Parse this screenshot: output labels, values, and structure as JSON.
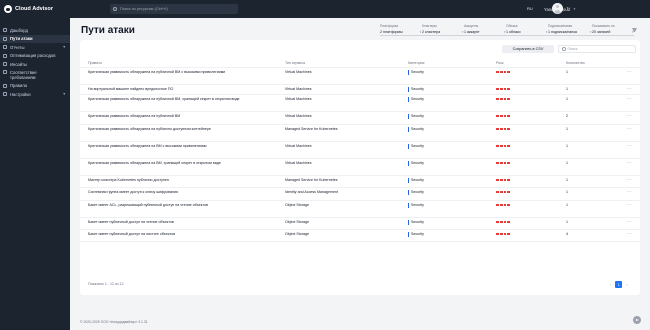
{
  "brand": {
    "name": "Cloud Advisor"
  },
  "sidebar": {
    "items": [
      {
        "label": "Дашборд"
      },
      {
        "label": "Пути атаки"
      },
      {
        "label": "Отчеты"
      },
      {
        "label": "Оптимизация расходов"
      },
      {
        "label": "Инсайты"
      },
      {
        "label": "Соответствие требованиям"
      },
      {
        "label": "Правила"
      },
      {
        "label": "Настройки"
      }
    ]
  },
  "topbar": {
    "search_placeholder": "Поиск по ресурсам (Ctrl+K)",
    "lang": "RU",
    "cloud": "Yandex Cloud"
  },
  "page": {
    "title": "Пути атаки"
  },
  "filters": [
    {
      "label": "Платформа",
      "value": "2 платформы"
    },
    {
      "label": "Кластеры",
      "value": "2 кластера"
    },
    {
      "label": "Аккаунты",
      "value": "1 аккаунт"
    },
    {
      "label": "Облака",
      "value": "1 облако"
    },
    {
      "label": "Подписки/папки",
      "value": "1 подписка/папка"
    },
    {
      "label": "Показывать по",
      "value": "20 записей"
    }
  ],
  "toolbar": {
    "export_label": "Сохранить в CSV",
    "search_placeholder": "Поиск"
  },
  "table": {
    "headers": {
      "rule": "Правило",
      "service": "Тип сервиса",
      "category": "Категория",
      "risk": "Риск",
      "count": "Количество"
    },
    "rows": [
      {
        "rule": "Критическая уязвимость обнаружена на публичной ВМ с высокими привилегиями",
        "service": "Virtual Machines",
        "category": "Security",
        "count": "1"
      },
      {
        "rule": "На виртуальной машине найдено вредоносное ПО",
        "service": "Virtual Machines",
        "category": "Security",
        "count": "1"
      },
      {
        "rule": "Критическая уязвимость обнаружена на публичной ВМ, хранящей секрет в открытом виде",
        "service": "Virtual Machines",
        "category": "Security",
        "count": "1"
      },
      {
        "rule": "Критическая уязвимость обнаружена на публичной ВМ",
        "service": "Virtual Machines",
        "category": "Security",
        "count": "2"
      },
      {
        "rule": "Критическая уязвимость обнаружена на публично доступном контейнере",
        "service": "Managed Service for Kubernetes",
        "category": "Security",
        "count": "1"
      },
      {
        "rule": "Критическая уязвимость обнаружена на ВМ с высокими привилегиями",
        "service": "Virtual Machines",
        "category": "Security",
        "count": "1"
      },
      {
        "rule": "Критическая уязвимость обнаружена на ВМ, хранящей секрет в открытом виде",
        "service": "Virtual Machines",
        "category": "Security",
        "count": "1"
      },
      {
        "rule": "Мастер кластера Kubernetes публично доступен",
        "service": "Managed Service for Kubernetes",
        "category": "Security",
        "count": "1"
      },
      {
        "rule": "Системная группа имеет доступ к ключу шифрования",
        "service": "Identity and Access Management",
        "category": "Security",
        "count": "1"
      },
      {
        "rule": "Бакет имеет ACL, разрешающий публичный доступ на чтение объектов",
        "service": "Object Storage",
        "category": "Security",
        "count": "1"
      },
      {
        "rule": "Бакет имеет публичный доступ на чтение объектов",
        "service": "Object Storage",
        "category": "Security",
        "count": "1"
      },
      {
        "rule": "Бакет имеет публичный доступ на листинг объектов",
        "service": "Object Storage",
        "category": "Security",
        "count": "4"
      }
    ]
  },
  "pagination": {
    "summary": "Показано 1 - 12 из 12",
    "current_page": "1"
  },
  "footer": {
    "copyright": "© 2020-2025 ООО «Клаудадвайзер» 3.1.31"
  },
  "colors": {
    "accent": "#1d74f5",
    "risk": "#e53935",
    "category_bar": "#2563eb",
    "sidebar_bg": "#1c2430"
  },
  "risk_level": "4/4"
}
